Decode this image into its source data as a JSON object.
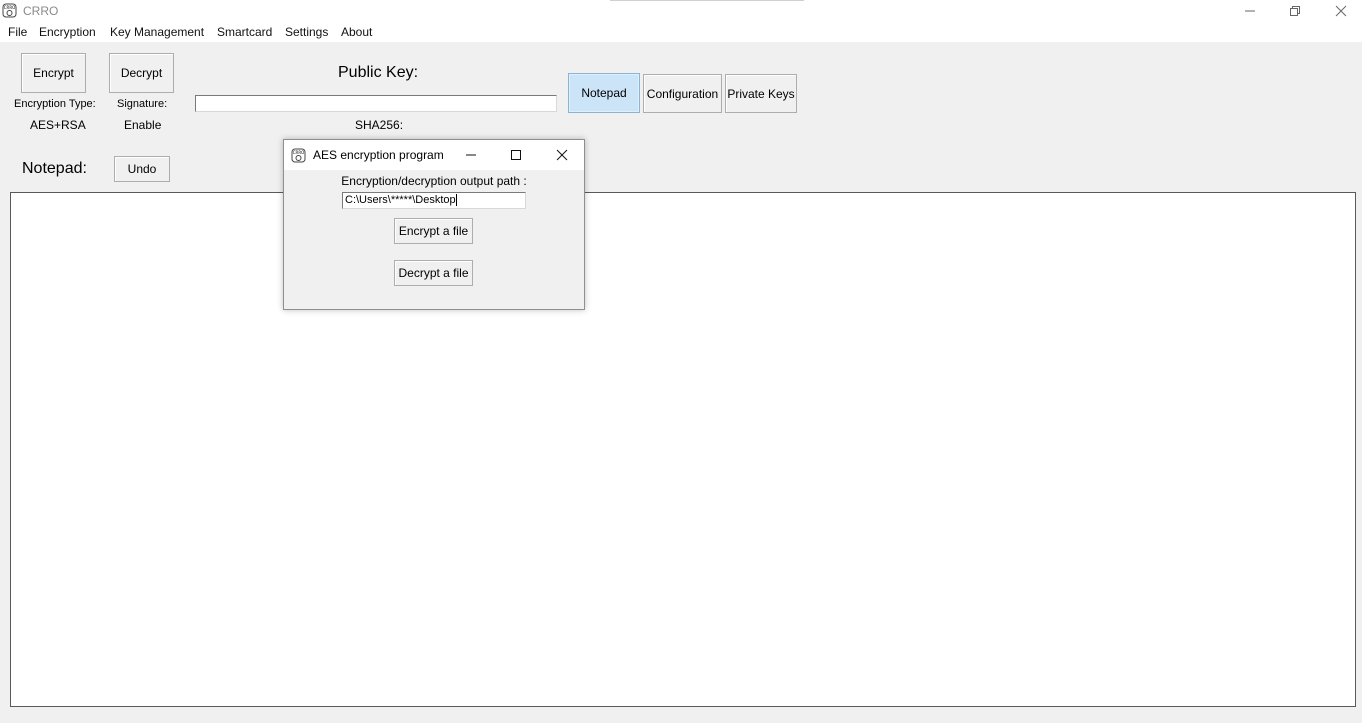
{
  "window": {
    "title": "CRRO",
    "app_icon": "crro-logo-icon",
    "controls": [
      "minimize-icon",
      "restore-icon",
      "close-icon"
    ]
  },
  "menu": [
    "File",
    "Encryption",
    "Key Management",
    "Smartcard",
    "Settings",
    "About"
  ],
  "toolbar": {
    "encrypt_label": "Encrypt",
    "decrypt_label": "Decrypt",
    "encryption_type_label": "Encryption Type:",
    "encryption_type_value": "AES+RSA",
    "signature_label": "Signature:",
    "signature_value": "Enable",
    "public_key_label": "Public Key:",
    "public_key_value": "",
    "sha_label": "SHA256:"
  },
  "tabs": [
    {
      "label": "Notepad",
      "active": true
    },
    {
      "label": "Configuration",
      "active": false
    },
    {
      "label": "Private Keys",
      "active": false
    }
  ],
  "notepad": {
    "label": "Notepad:",
    "undo_label": "Undo",
    "content": ""
  },
  "dialog": {
    "title": "AES encryption program",
    "path_label": "Encryption/decryption output path :",
    "path_value": "C:\\Users\\*****\\Desktop",
    "encrypt_file_label": "Encrypt a file",
    "decrypt_file_label": "Decrypt a file"
  },
  "colors": {
    "active_tab_bg": "#cce4f7",
    "window_bg": "#f0f0f0"
  }
}
